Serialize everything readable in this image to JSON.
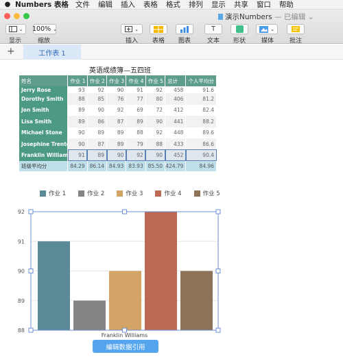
{
  "menubar": {
    "app": "Numbers 表格",
    "items": [
      "文件",
      "编辑",
      "插入",
      "表格",
      "格式",
      "排列",
      "显示",
      "共享",
      "窗口",
      "帮助"
    ]
  },
  "window": {
    "doc_title": "演示Numbers",
    "doc_status": "— 已编辑",
    "chevron": "⌄"
  },
  "toolbar": {
    "display": "显示",
    "zoom_value": "100%",
    "zoom_label": "缩放",
    "insert": "插入",
    "table": "表格",
    "chart": "图表",
    "text": "文本",
    "shape": "形状",
    "media": "媒体",
    "comment": "批注"
  },
  "sheets": {
    "add": "+",
    "tabs": [
      "工作表 1"
    ]
  },
  "table": {
    "title": "英语成绩簿—五四班",
    "headers": [
      "姓名",
      "作业 1",
      "作业 2",
      "作业 3",
      "作业 4",
      "作业 5",
      "总计",
      "个人平均分"
    ],
    "rows": [
      {
        "name": "Jerry Rose",
        "vals": [
          "93",
          "92",
          "90",
          "91",
          "92",
          "458",
          "91.6"
        ]
      },
      {
        "name": "Dorothy Smith",
        "vals": [
          "88",
          "85",
          "76",
          "77",
          "80",
          "406",
          "81.2"
        ]
      },
      {
        "name": "Jon Smith",
        "vals": [
          "89",
          "90",
          "92",
          "69",
          "72",
          "412",
          "82.4"
        ]
      },
      {
        "name": "Lisa Smith",
        "vals": [
          "89",
          "86",
          "87",
          "89",
          "90",
          "441",
          "88.2"
        ]
      },
      {
        "name": "Michael Stone",
        "vals": [
          "90",
          "89",
          "89",
          "88",
          "92",
          "448",
          "89.6"
        ]
      },
      {
        "name": "Josephine Trenton",
        "vals": [
          "90",
          "87",
          "89",
          "79",
          "88",
          "433",
          "86.6"
        ]
      },
      {
        "name": "Franklin Williams",
        "vals": [
          "91",
          "89",
          "90",
          "92",
          "90",
          "452",
          "90.4"
        ]
      }
    ],
    "footer": {
      "label": "班级平均分",
      "vals": [
        "84.29",
        "86.14",
        "84.93",
        "83.93",
        "85.50",
        "424.79",
        "84.96"
      ]
    }
  },
  "chart_data": {
    "type": "bar",
    "categories": [
      "Franklin Williams"
    ],
    "series": [
      {
        "name": "作业 1",
        "values": [
          91
        ],
        "color": "#5b8a97"
      },
      {
        "name": "作业 2",
        "values": [
          89
        ],
        "color": "#858585"
      },
      {
        "name": "作业 3",
        "values": [
          90
        ],
        "color": "#d3a466"
      },
      {
        "name": "作业 4",
        "values": [
          92
        ],
        "color": "#bd6a55"
      },
      {
        "name": "作业 5",
        "values": [
          90
        ],
        "color": "#8d7257"
      }
    ],
    "ylim": [
      88,
      92
    ],
    "yticks": [
      "88",
      "89",
      "90",
      "91",
      "92"
    ],
    "legend": "top",
    "grid": true
  },
  "edit_button": "编辑数据引用"
}
